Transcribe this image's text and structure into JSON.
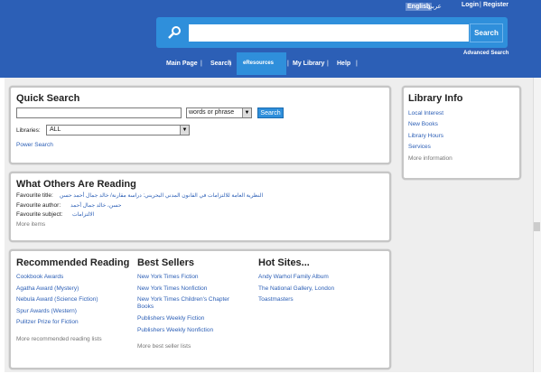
{
  "header": {
    "lang_english": "English",
    "lang_arabic": "عربي",
    "login": "Login",
    "separator": "|",
    "register": "Register",
    "search_button": "Search",
    "advanced_search": "Advanced Search",
    "nav": [
      "Main Page",
      "Search",
      "eResources",
      "My Library",
      "Help"
    ],
    "nav_sep": "|"
  },
  "quick_search": {
    "title": "Quick Search",
    "mode_value": "words or phrase",
    "button": "Search",
    "libraries_label": "Libraries:",
    "libraries_value": "ALL",
    "power_search": "Power Search"
  },
  "others_reading": {
    "title": "What Others Are Reading",
    "title_label": "Favourite title:",
    "title_value": "النظرية العامة للالتزامات في القانون المدني البحريني: دراسة مقارنة/ خالد جمال أحمد حسن",
    "author_label": "Favourite author:",
    "author_value": "حسن، خالد جمال أحمد",
    "subject_label": "Favourite subject:",
    "subject_value": "الالتزامات",
    "more": "More items"
  },
  "library_info": {
    "title": "Library Info",
    "links": [
      "Local Interest",
      "New Books",
      "Library Hours",
      "Services"
    ],
    "more": "More information"
  },
  "recommended": {
    "title": "Recommended Reading",
    "links": [
      "Cookbook Awards",
      "Agatha Award (Mystery)",
      "Nebula Award (Science Fiction)",
      "Spur Awards (Western)",
      "Pulitzer Prize for Fiction"
    ],
    "more": "More recommended reading lists"
  },
  "best_sellers": {
    "title": "Best Sellers",
    "links": [
      "New York Times Fiction",
      "New York Times Nonfiction",
      "New York Times Children's Chapter Books",
      "Publishers Weekly Fiction",
      "Publishers Weekly Nonfiction"
    ],
    "more": "More best seller lists"
  },
  "hot_sites": {
    "title": "Hot Sites...",
    "links": [
      "Andy Warhol Family Album",
      "The National Gallery, London",
      "Toastmasters"
    ]
  },
  "colors": {
    "header_bg": "#2c5fb6",
    "accent": "#2f8fdb",
    "link": "#2c5fb6"
  }
}
